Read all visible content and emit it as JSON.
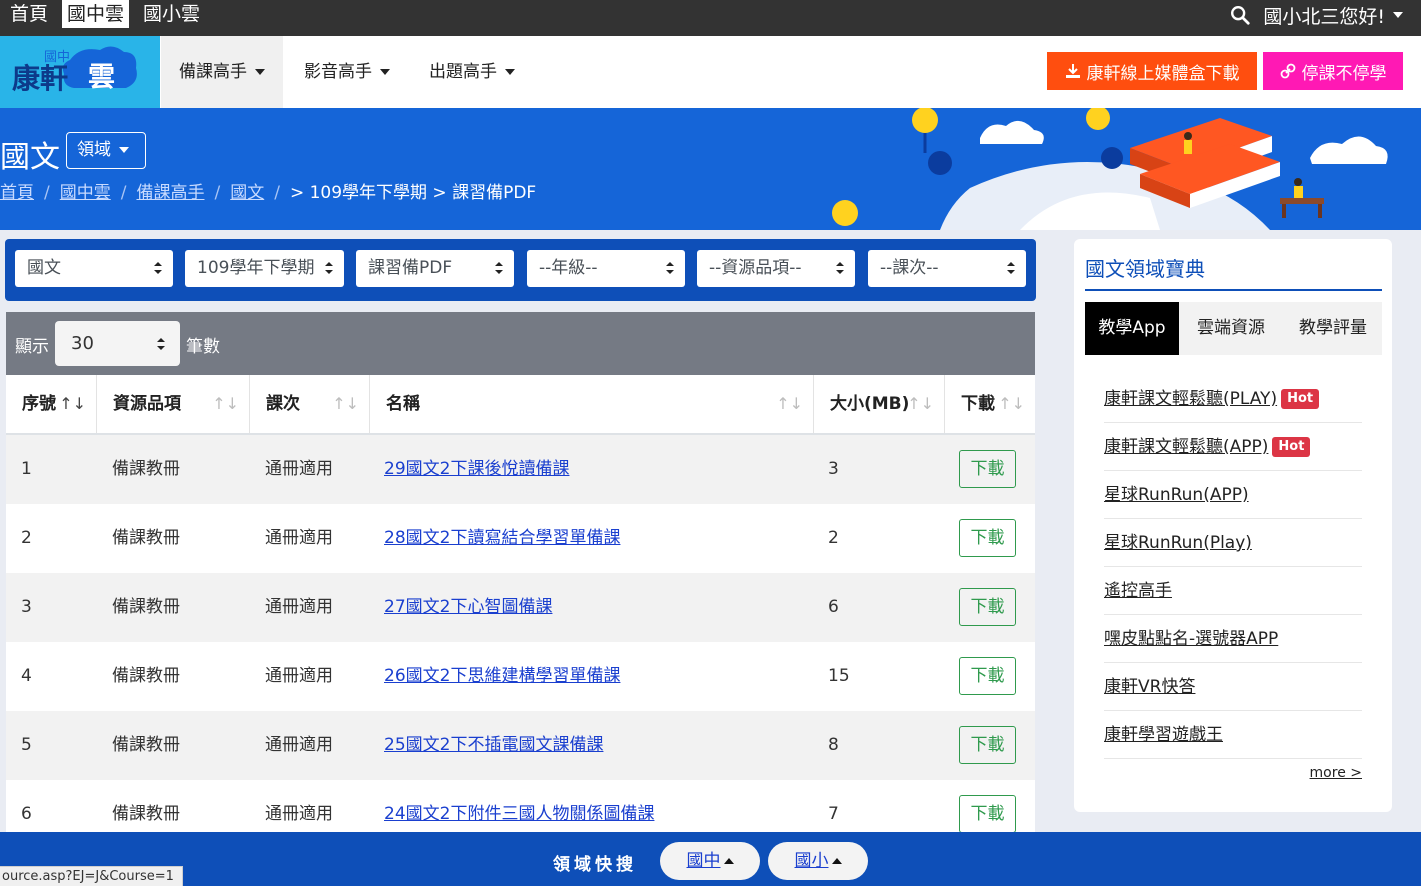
{
  "topbar": {
    "tabs": [
      {
        "label": "首頁"
      },
      {
        "label": "國中雲"
      },
      {
        "label": "國小雲"
      }
    ],
    "greeting": "國小北三您好!"
  },
  "header": {
    "logo_small": "國中",
    "logo_main": "康軒",
    "logo_cloud": "雲",
    "nav": [
      {
        "label": "備課高手"
      },
      {
        "label": "影音高手"
      },
      {
        "label": "出題高手"
      }
    ],
    "download_button": "康軒線上媒體盒下載",
    "stop_button": "停課不停學"
  },
  "banner": {
    "title": "國文",
    "domain_button": "領域",
    "breadcrumb": [
      "首頁",
      "國中雲",
      "備課高手",
      "國文"
    ],
    "breadcrumb_tail": "> 109學年下學期 > 課習備PDF"
  },
  "filters": [
    {
      "value": "國文"
    },
    {
      "value": "109學年下學期"
    },
    {
      "value": "課習備PDF"
    },
    {
      "value": "--年級--"
    },
    {
      "value": "--資源品項--"
    },
    {
      "value": "--課次--"
    }
  ],
  "table": {
    "show_label": "顯示",
    "page_size": "30",
    "count_label": "筆數",
    "columns": [
      {
        "label": "序號"
      },
      {
        "label": "資源品項"
      },
      {
        "label": "課次"
      },
      {
        "label": "名稱"
      },
      {
        "label": "大小(MB)"
      },
      {
        "label": "下載"
      }
    ],
    "download_label": "下載",
    "rows": [
      {
        "no": "1",
        "item": "備課教冊",
        "lesson": "通冊適用",
        "name": "29國文2下課後悅讀備課",
        "size": "3"
      },
      {
        "no": "2",
        "item": "備課教冊",
        "lesson": "通冊適用",
        "name": "28國文2下讀寫結合學習單備課",
        "size": "2"
      },
      {
        "no": "3",
        "item": "備課教冊",
        "lesson": "通冊適用",
        "name": "27國文2下心智圖備課",
        "size": "6"
      },
      {
        "no": "4",
        "item": "備課教冊",
        "lesson": "通冊適用",
        "name": "26國文2下思維建構學習單備課",
        "size": "15"
      },
      {
        "no": "5",
        "item": "備課教冊",
        "lesson": "通冊適用",
        "name": "25國文2下不插電國文課備課",
        "size": "8"
      },
      {
        "no": "6",
        "item": "備課教冊",
        "lesson": "通冊適用",
        "name": "24國文2下附件三國人物關係圖備課",
        "size": "7"
      }
    ]
  },
  "side": {
    "title": "國文領域寶典",
    "tabs": [
      {
        "label": "教學App"
      },
      {
        "label": "雲端資源"
      },
      {
        "label": "教學評量"
      }
    ],
    "hot_label": "Hot",
    "items": [
      {
        "label": "康軒課文輕鬆聽(PLAY)"
      },
      {
        "label": "康軒課文輕鬆聽(APP)"
      },
      {
        "label": "星球RunRun(APP)"
      },
      {
        "label": "星球RunRun(Play)"
      },
      {
        "label": "遙控高手"
      },
      {
        "label": "嘿皮點點名-選號器APP"
      },
      {
        "label": "康軒VR快答"
      },
      {
        "label": "康軒學習遊戲王"
      }
    ],
    "more": "more >"
  },
  "bottom": {
    "label": "領域快搜",
    "buttons": [
      {
        "label": "國中"
      },
      {
        "label": "國小"
      }
    ]
  },
  "status_url": "ource.asp?EJ=J&Course=1",
  "colors": {
    "topbar": "#333333",
    "logo_bg": "#29b4e8",
    "banner": "#1565d8",
    "filter_bar": "#0e4fb8",
    "download_orange": "#ff4e0f",
    "stop_pink": "#ff19b4",
    "hot_red": "#dc3545",
    "download_green": "#2f9a4d"
  }
}
